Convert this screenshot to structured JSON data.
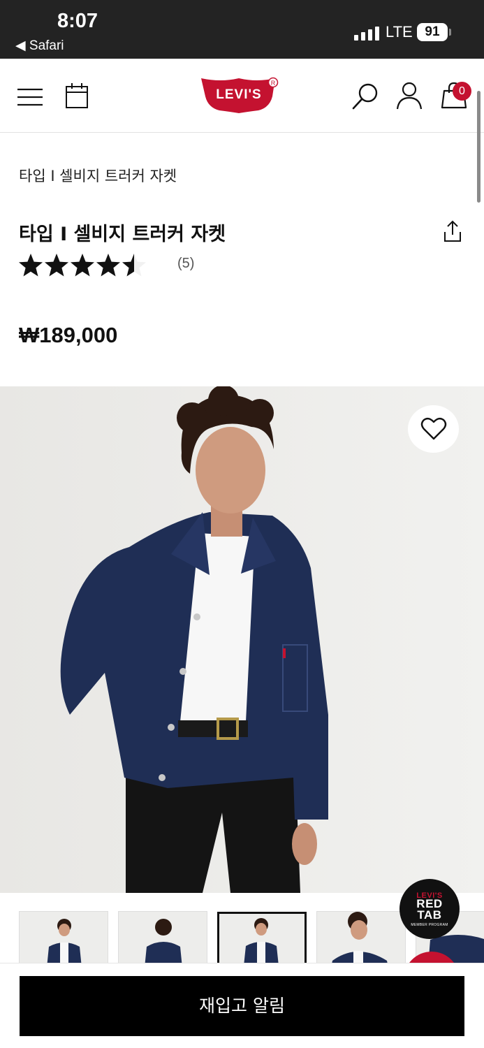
{
  "status_bar": {
    "time": "8:07",
    "back_app": "◀ Safari",
    "network": "LTE",
    "battery": "91"
  },
  "header": {
    "brand": "Levi's",
    "icons": [
      "menu-icon",
      "calendar-icon",
      "search-icon",
      "account-icon",
      "shopping-bag-icon"
    ],
    "cart_count": "0"
  },
  "product": {
    "breadcrumb": "타입 I 셀비지 트러커 자켓",
    "title": "타입 I 셀비지 트러커 자켓",
    "rating": 4.5,
    "rating_max": 5,
    "review_count": "(5)",
    "price": "₩189,000"
  },
  "gallery": {
    "thumbnail_count": 5,
    "active_thumbnail": 3
  },
  "red_tab": {
    "brand": "LEVI'S",
    "line1": "RED",
    "line2": "TAB",
    "sub": "MEMBER PROGRAM"
  },
  "actions": {
    "notify_label": "재입고 알림"
  },
  "colors": {
    "brand_red": "#c41230",
    "button": "#000000",
    "denim": "#1f2e55"
  }
}
